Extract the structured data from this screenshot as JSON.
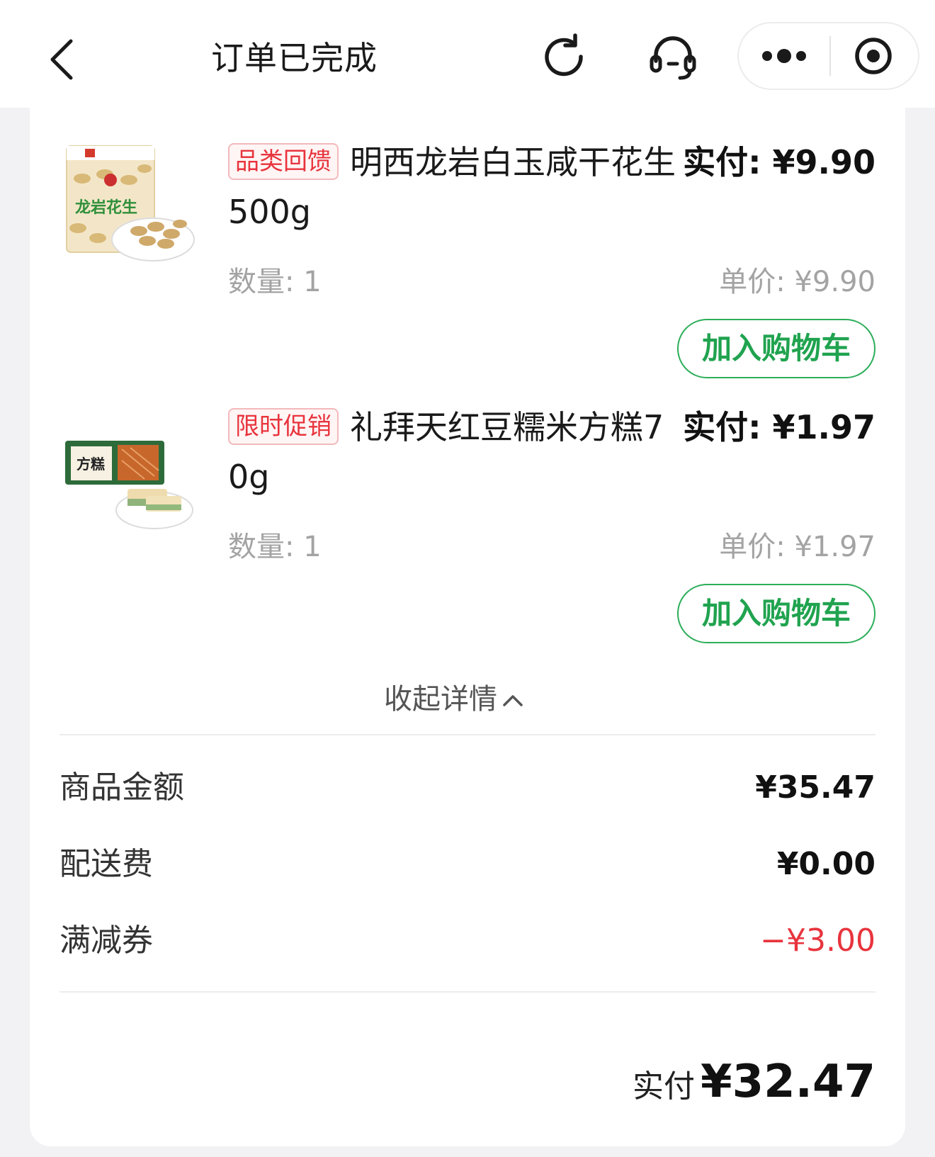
{
  "header": {
    "title": "订单已完成"
  },
  "items": [
    {
      "badge": "品类回馈",
      "name": "明西龙岩白玉咸干花生500g",
      "paid": "实付: ¥9.90",
      "quantity": "数量: 1",
      "unit_price": "单价: ¥9.90",
      "add_cart_label": "加入购物车",
      "image_text": "龙岩花生"
    },
    {
      "badge": "限时促销",
      "name": "礼拜天红豆糯米方糕70g",
      "paid": "实付: ¥1.97",
      "quantity": "数量: 1",
      "unit_price": "单价: ¥1.97",
      "add_cart_label": "加入购物车",
      "image_text": "方糕"
    }
  ],
  "collapse_label": "收起详情",
  "summary": {
    "goods_label": "商品金额",
    "goods_value": "¥35.47",
    "delivery_label": "配送费",
    "delivery_value": "¥0.00",
    "coupon_label": "满减券",
    "coupon_value": "−¥3.00"
  },
  "total": {
    "label": "实付",
    "value": "¥32.47"
  },
  "colors": {
    "accent_green": "#20a34f",
    "badge_red": "#e8343d",
    "discount_red": "#e8343d"
  },
  "icons": [
    "back-icon",
    "refresh-icon",
    "headset-icon",
    "more-icon",
    "target-icon",
    "chevron-up-icon"
  ]
}
